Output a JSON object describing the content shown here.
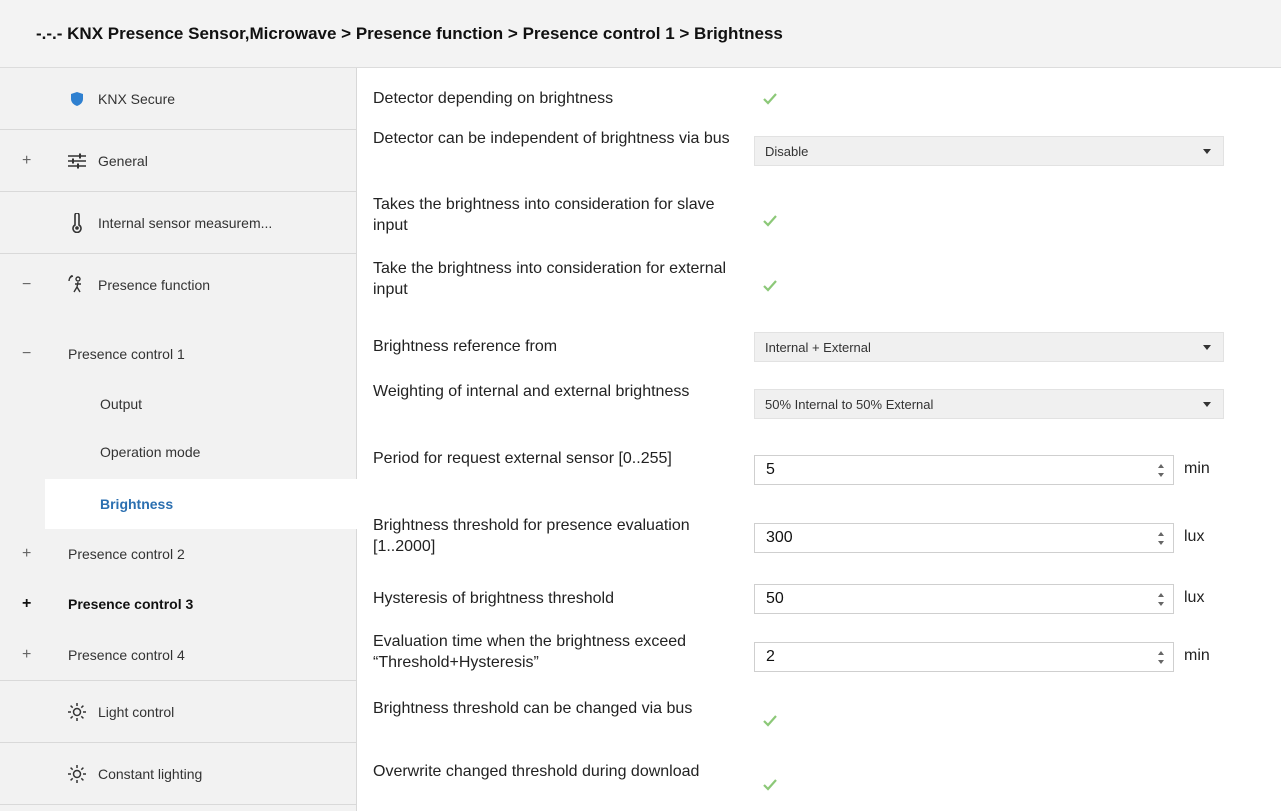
{
  "title": "-.-.- KNX Presence Sensor,Microwave > Presence function > Presence control 1 > Brightness",
  "sidebar": {
    "knx_secure": "KNX Secure",
    "general": "General",
    "internal_sensor": "Internal sensor measurem...",
    "presence_function": "Presence function",
    "presence_control_1": "Presence control 1",
    "output": "Output",
    "operation_mode": "Operation mode",
    "brightness": "Brightness",
    "presence_control_2": "Presence control 2",
    "presence_control_3": "Presence control 3",
    "presence_control_4": "Presence control 4",
    "light_control": "Light control",
    "constant_lighting": "Constant lighting",
    "expand_plus": "+",
    "collapse_minus": "−"
  },
  "params": {
    "p1_label": "Detector depending on brightness",
    "p1_checked": true,
    "p2_label": "Detector can be independent of brightness via bus",
    "p2_value": "Disable",
    "p3_label": "Takes the brightness into consideration for slave input",
    "p3_checked": true,
    "p4_label": "Take the brightness into consideration for external input",
    "p4_checked": true,
    "p5_label": "Brightness reference from",
    "p5_value": "Internal + External",
    "p6_label": "Weighting of internal and external brightness",
    "p6_value": "50% Internal to 50% External",
    "p7_label": "Period for request external sensor [0..255]",
    "p7_value": "5",
    "p7_unit": "min",
    "p8_label": "Brightness threshold for presence evaluation [1..2000]",
    "p8_value": "300",
    "p8_unit": "lux",
    "p9_label": "Hysteresis of brightness threshold",
    "p9_value": "50",
    "p9_unit": "lux",
    "p10_label": "Evaluation time when the brightness exceed “Threshold+Hysteresis”",
    "p10_value": "2",
    "p10_unit": "min",
    "p11_label": "Brightness threshold can be changed via bus",
    "p11_checked": true,
    "p12_label": "Overwrite changed threshold during download",
    "p12_checked": true
  },
  "colors": {
    "check": "#8cc878",
    "active_link": "#2b6fb0",
    "shield": "#2f80d0"
  }
}
